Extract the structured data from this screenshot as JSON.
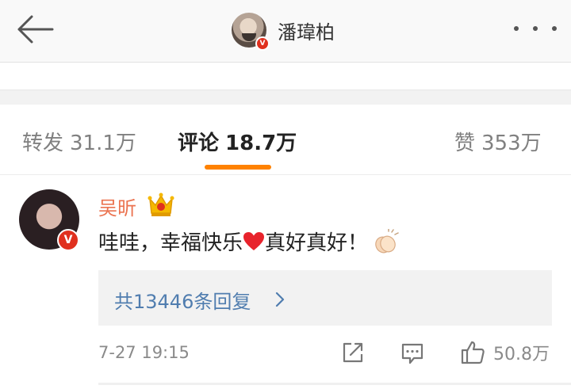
{
  "header": {
    "title": "潘瑋柏"
  },
  "tabs": {
    "repost": {
      "label": "转发",
      "count": "31.1万"
    },
    "comments": {
      "label": "评论",
      "count": "18.7万"
    },
    "likes": {
      "label": "赞",
      "count": "353万"
    }
  },
  "comment": {
    "user_name": "吴昕",
    "text_before": "哇哇，幸福快乐",
    "text_after": "真好真好！",
    "replies_label": "共13446条回复",
    "time": "7-27 19:15",
    "like_count": "50.8万"
  },
  "colors": {
    "accent": "#ff8200",
    "username": "#eb7350",
    "link": "#507daf"
  },
  "icons": {
    "back": "back-arrow-icon",
    "more": "more-dots-icon",
    "verified": "verified-badge-icon",
    "crown": "crown-icon",
    "heart": "heart-icon",
    "clap": "clap-icon",
    "chevron": "chevron-right-icon",
    "share": "share-icon",
    "reply": "comment-icon",
    "like": "thumbs-up-icon"
  }
}
